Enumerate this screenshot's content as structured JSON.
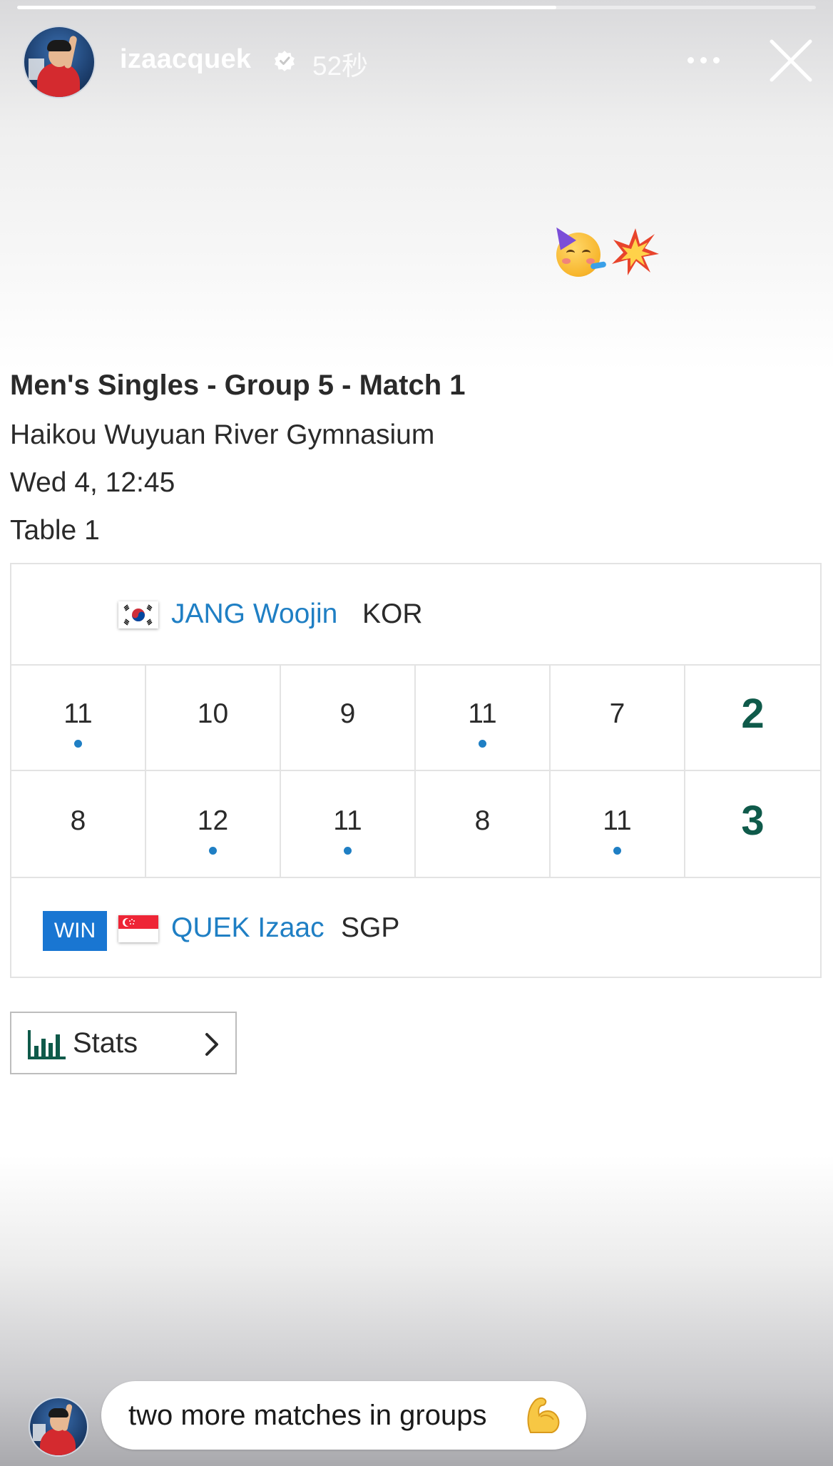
{
  "story": {
    "progress_fraction": 0.675,
    "username": "izaacquek",
    "time_ago": "52秒",
    "verified": true,
    "sticker": {
      "icons": [
        "partying-face-icon",
        "collision-icon"
      ]
    }
  },
  "match": {
    "title": "Men's Singles - Group 5 - Match 1",
    "venue": "Haikou Wuyuan River Gymnasium",
    "datetime": "Wed 4, 12:45",
    "table": "Table 1",
    "player_top": {
      "name": "JANG Woojin",
      "country": "KOR",
      "flag": "south-korea-flag-icon"
    },
    "player_bottom": {
      "name": "QUEK Izaac",
      "country": "SGP",
      "flag": "singapore-flag-icon",
      "badge": "WIN"
    },
    "games_top": [
      "11",
      "10",
      "9",
      "11",
      "7"
    ],
    "games_bottom": [
      "8",
      "12",
      "11",
      "8",
      "11"
    ],
    "games_won_by_top": [
      true,
      false,
      false,
      true,
      false
    ],
    "total_top": "2",
    "total_bottom": "3",
    "stats_label": "Stats"
  },
  "reply": {
    "text": "two more matches in groups",
    "emoji": "flexed-biceps-icon"
  },
  "colors": {
    "link_blue": "#1f7fc4",
    "win_blue": "#1976d2",
    "total_green": "#0f5a4a",
    "text_dark": "#2a2a2a"
  }
}
